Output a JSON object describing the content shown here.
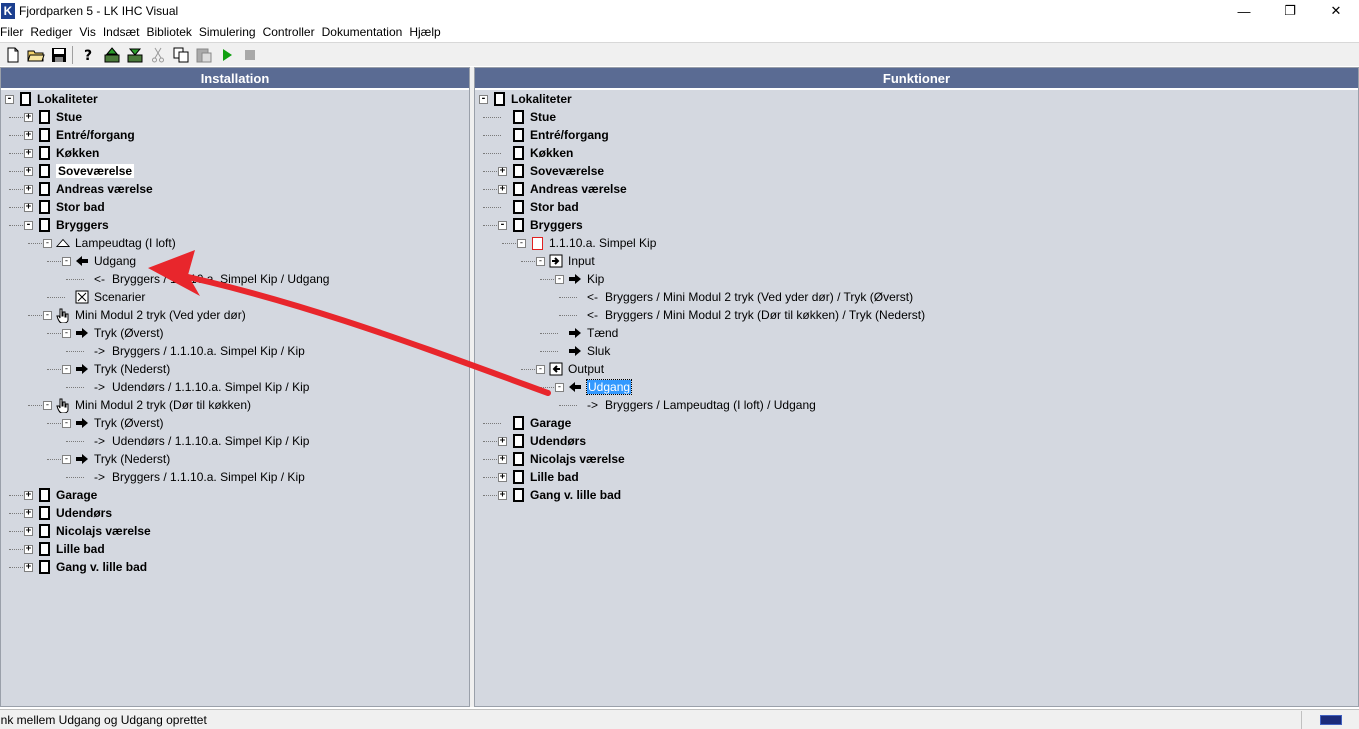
{
  "window": {
    "icon_letter": "K",
    "title": "Fjordparken 5 - LK IHC Visual",
    "minimize": "—",
    "maximize": "❐",
    "close": "✕"
  },
  "menu": [
    "Filer",
    "Rediger",
    "Vis",
    "Indsæt",
    "Bibliotek",
    "Simulering",
    "Controller",
    "Dokumentation",
    "Hjælp"
  ],
  "left_panel": {
    "header": "Installation",
    "nodes": [
      {
        "text": "Lokaliteter",
        "bold": true
      },
      {
        "text": "Stue",
        "bold": true
      },
      {
        "text": "Entré/forgang",
        "bold": true
      },
      {
        "text": "Køkken",
        "bold": true
      },
      {
        "text": "Soveværelse",
        "bold": true
      },
      {
        "text": "Andreas værelse",
        "bold": true
      },
      {
        "text": "Stor bad",
        "bold": true
      },
      {
        "text": "Bryggers",
        "bold": true
      },
      {
        "text": "Lampeudtag (I loft)",
        "bold": false
      },
      {
        "text": "Udgang",
        "bold": false
      },
      {
        "text": "Bryggers / 1.1.10.a. Simpel Kip / Udgang",
        "bold": false
      },
      {
        "text": "Scenarier",
        "bold": false
      },
      {
        "text": "Mini Modul 2 tryk (Ved yder dør)",
        "bold": false
      },
      {
        "text": "Tryk (Øverst)",
        "bold": false
      },
      {
        "text": "Bryggers / 1.1.10.a. Simpel Kip / Kip",
        "bold": false
      },
      {
        "text": "Tryk (Nederst)",
        "bold": false
      },
      {
        "text": "Udendørs / 1.1.10.a. Simpel Kip / Kip",
        "bold": false
      },
      {
        "text": "Mini Modul 2 tryk (Dør til køkken)",
        "bold": false
      },
      {
        "text": "Tryk (Øverst)",
        "bold": false
      },
      {
        "text": "Udendørs / 1.1.10.a. Simpel Kip / Kip",
        "bold": false
      },
      {
        "text": "Tryk (Nederst)",
        "bold": false
      },
      {
        "text": "Bryggers / 1.1.10.a. Simpel Kip / Kip",
        "bold": false
      },
      {
        "text": "Garage",
        "bold": true
      },
      {
        "text": "Udendørs",
        "bold": true
      },
      {
        "text": "Nicolajs værelse",
        "bold": true
      },
      {
        "text": "Lille bad",
        "bold": true
      },
      {
        "text": "Gang v. lille bad",
        "bold": true
      }
    ]
  },
  "right_panel": {
    "header": "Funktioner",
    "nodes": [
      {
        "text": "Lokaliteter",
        "bold": true
      },
      {
        "text": "Stue",
        "bold": true
      },
      {
        "text": "Entré/forgang",
        "bold": true
      },
      {
        "text": "Køkken",
        "bold": true
      },
      {
        "text": "Soveværelse",
        "bold": true
      },
      {
        "text": "Andreas værelse",
        "bold": true
      },
      {
        "text": "Stor bad",
        "bold": true
      },
      {
        "text": "Bryggers",
        "bold": true
      },
      {
        "text": "1.1.10.a. Simpel Kip",
        "bold": false
      },
      {
        "text": "Input",
        "bold": false
      },
      {
        "text": "Kip",
        "bold": false
      },
      {
        "text": "Bryggers / Mini Modul 2 tryk (Ved yder dør)  / Tryk (Øverst)",
        "bold": false
      },
      {
        "text": "Bryggers / Mini Modul 2 tryk (Dør til køkken)  / Tryk (Nederst)",
        "bold": false
      },
      {
        "text": "Tænd",
        "bold": false
      },
      {
        "text": "Sluk",
        "bold": false
      },
      {
        "text": "Output",
        "bold": false
      },
      {
        "text": "Udgang",
        "bold": false
      },
      {
        "text": "Bryggers / Lampeudtag (I loft)  / Udgang",
        "bold": false
      },
      {
        "text": "Garage",
        "bold": true
      },
      {
        "text": "Udendørs",
        "bold": true
      },
      {
        "text": "Nicolajs værelse",
        "bold": true
      },
      {
        "text": "Lille bad",
        "bold": true
      },
      {
        "text": "Gang v. lille bad",
        "bold": true
      }
    ]
  },
  "link_prefix_in": "<-",
  "link_prefix_out": "->",
  "status": {
    "text": "ink mellem Udgang og Udgang oprettet"
  },
  "colors": {
    "panel_header": "#5a6b93",
    "panel_bg": "#d4d8e0",
    "selection": "#3399ff",
    "annotation_arrow": "#e8262c"
  }
}
